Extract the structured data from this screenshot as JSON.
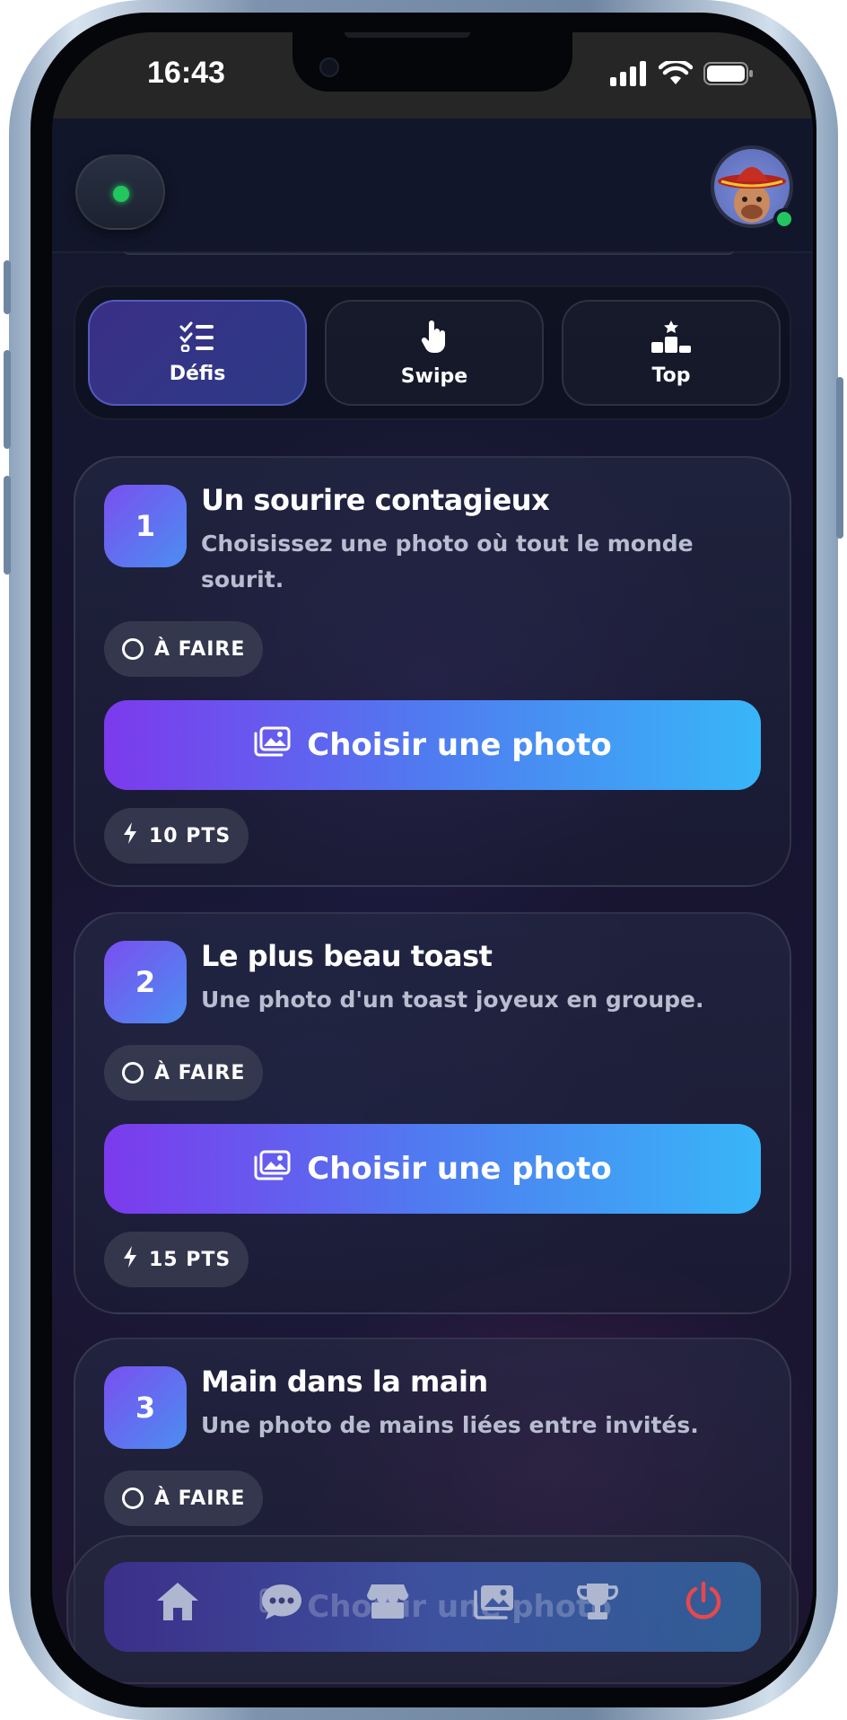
{
  "status_bar": {
    "time": "16:43"
  },
  "tabs": [
    {
      "label": "Défis",
      "icon": "checklist-icon",
      "active": true
    },
    {
      "label": "Swipe",
      "icon": "pointer-hand-icon",
      "active": false
    },
    {
      "label": "Top",
      "icon": "podium-icon",
      "active": false
    }
  ],
  "challenges": [
    {
      "number": "1",
      "title": "Un sourire contagieux",
      "description": "Choisissez une photo où tout le monde sourit.",
      "status": "À FAIRE",
      "cta": "Choisir une photo",
      "points": "10 PTS"
    },
    {
      "number": "2",
      "title": "Le plus beau toast",
      "description": "Une photo d'un toast joyeux en groupe.",
      "status": "À FAIRE",
      "cta": "Choisir une photo",
      "points": "15 PTS"
    },
    {
      "number": "3",
      "title": "Main dans la main",
      "description": "Une photo de mains liées entre invités.",
      "status": "À FAIRE",
      "cta": "Choisir une photo"
    }
  ],
  "bottom_nav": [
    {
      "name": "home-icon"
    },
    {
      "name": "chat-icon"
    },
    {
      "name": "shop-icon"
    },
    {
      "name": "gallery-icon"
    },
    {
      "name": "trophy-icon"
    },
    {
      "name": "power-icon"
    }
  ],
  "colors": {
    "accent_start": "#7c3aed",
    "accent_end": "#38b6f8",
    "online": "#22c55e",
    "power": "#e5484d"
  }
}
